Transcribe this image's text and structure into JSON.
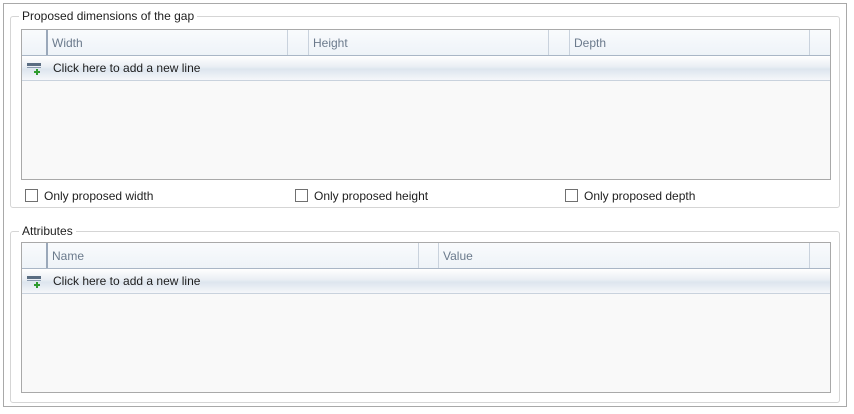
{
  "gap_group": {
    "title": "Proposed dimensions of the gap",
    "columns": [
      "Width",
      "Height",
      "Depth"
    ],
    "new_line_label": "Click here to add a new line",
    "rows": []
  },
  "options": [
    {
      "label": "Only proposed width",
      "checked": false
    },
    {
      "label": "Only proposed height",
      "checked": false
    },
    {
      "label": "Only proposed depth",
      "checked": false
    }
  ],
  "attributes_group": {
    "title": "Attributes",
    "columns": [
      "Name",
      "Value"
    ],
    "new_line_label": "Click here to add a new line",
    "rows": []
  },
  "icons": {
    "new_row": "add-row-icon",
    "checkbox": "checkbox-unchecked-icon"
  },
  "colors": {
    "grid_border": "#a9a9a9",
    "header_text": "#6b7a8c",
    "new_row_plus": "#2e9b2e"
  }
}
